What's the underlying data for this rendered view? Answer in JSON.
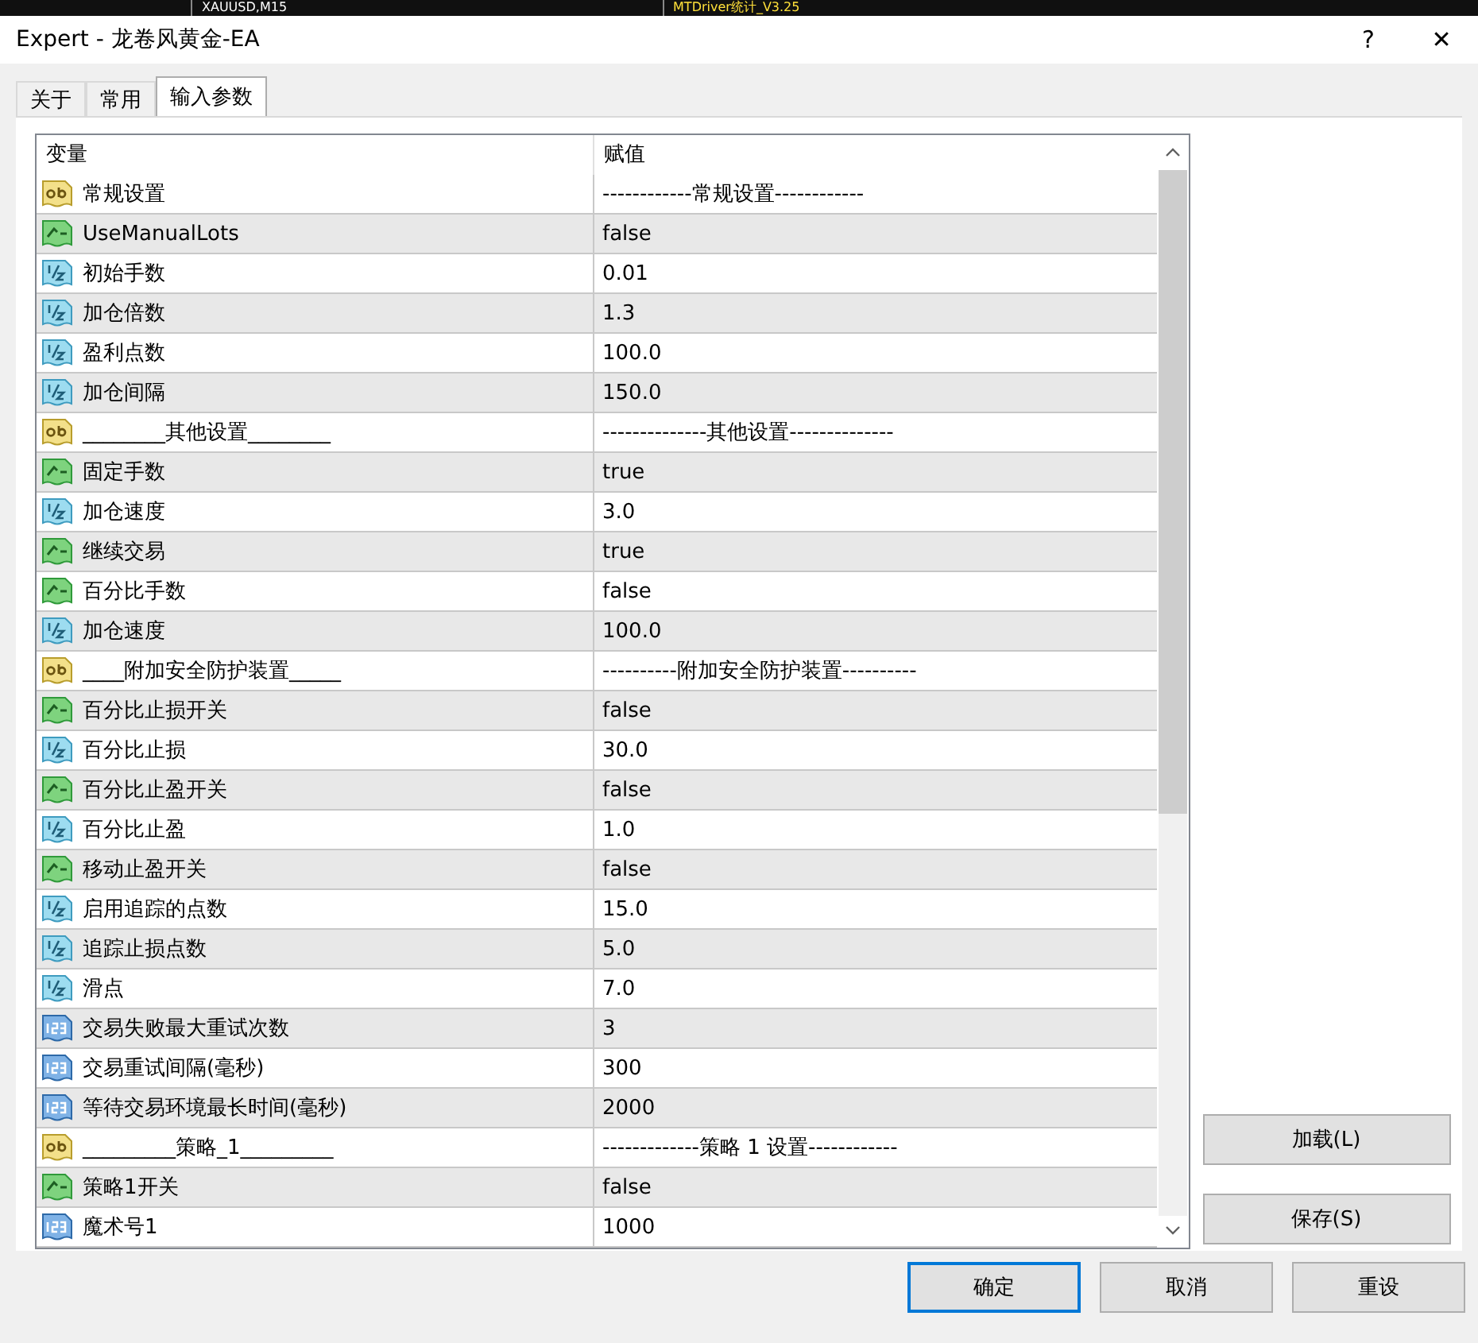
{
  "background_window": {
    "tabs": [
      "XAUUSD,M15",
      "MTDriver统计_V3.25"
    ]
  },
  "window": {
    "title": "Expert - 龙卷风黄金-EA",
    "help": "?",
    "close": "✕"
  },
  "tabs": [
    {
      "label": "关于",
      "selected": false
    },
    {
      "label": "常用",
      "selected": false
    },
    {
      "label": "输入参数",
      "selected": true
    }
  ],
  "table": {
    "columns": [
      "变量",
      "赋值"
    ],
    "rows": [
      {
        "kind": "string",
        "name": "常规设置",
        "value": "------------常规设置------------"
      },
      {
        "kind": "bool",
        "name": "UseManualLots",
        "value": "false"
      },
      {
        "kind": "double",
        "name": "初始手数",
        "value": "0.01"
      },
      {
        "kind": "double",
        "name": "加仓倍数",
        "value": "1.3"
      },
      {
        "kind": "double",
        "name": "盈利点数",
        "value": "100.0"
      },
      {
        "kind": "double",
        "name": "加仓间隔",
        "value": "150.0"
      },
      {
        "kind": "string",
        "name": "________其他设置________",
        "value": "--------------其他设置--------------"
      },
      {
        "kind": "bool",
        "name": "固定手数",
        "value": "true"
      },
      {
        "kind": "double",
        "name": "加仓速度",
        "value": "3.0"
      },
      {
        "kind": "bool",
        "name": "继续交易",
        "value": "true"
      },
      {
        "kind": "bool",
        "name": "百分比手数",
        "value": "false"
      },
      {
        "kind": "double",
        "name": "加仓速度",
        "value": "100.0"
      },
      {
        "kind": "string",
        "name": "____附加安全防护装置_____",
        "value": "----------附加安全防护装置----------"
      },
      {
        "kind": "bool",
        "name": "百分比止损开关",
        "value": "false"
      },
      {
        "kind": "double",
        "name": "百分比止损",
        "value": "30.0"
      },
      {
        "kind": "bool",
        "name": "百分比止盈开关",
        "value": "false"
      },
      {
        "kind": "double",
        "name": "百分比止盈",
        "value": "1.0"
      },
      {
        "kind": "bool",
        "name": "移动止盈开关",
        "value": "false"
      },
      {
        "kind": "double",
        "name": "启用追踪的点数",
        "value": "15.0"
      },
      {
        "kind": "double",
        "name": "追踪止损点数",
        "value": "5.0"
      },
      {
        "kind": "double",
        "name": "滑点",
        "value": "7.0"
      },
      {
        "kind": "int",
        "name": "交易失败最大重试次数",
        "value": "3"
      },
      {
        "kind": "int",
        "name": "交易重试间隔(毫秒)",
        "value": "300"
      },
      {
        "kind": "int",
        "name": "等待交易环境最长时间(毫秒)",
        "value": "2000"
      },
      {
        "kind": "string",
        "name": "_________策略_1_________",
        "value": "-------------策略 1 设置------------"
      },
      {
        "kind": "bool",
        "name": "策略1开关",
        "value": "false"
      },
      {
        "kind": "int",
        "name": "魔术号1",
        "value": "1000"
      }
    ]
  },
  "side_buttons": [
    "加载(L)",
    "保存(S)"
  ],
  "buttons": [
    {
      "label": "确定",
      "focused": true
    },
    {
      "label": "取消",
      "focused": false
    },
    {
      "label": "重设",
      "focused": false
    }
  ]
}
